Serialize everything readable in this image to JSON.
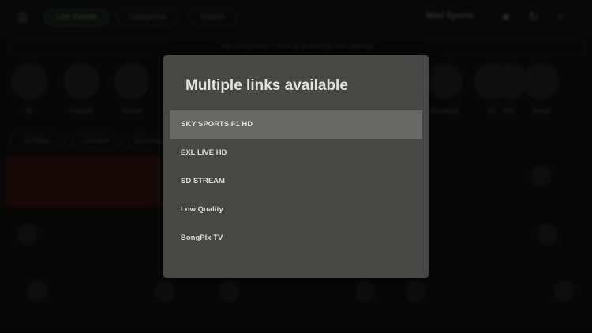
{
  "topbar": {
    "menu_icon": "menu-icon",
    "tabs": [
      "Live Events",
      "Categories",
      "Search"
    ],
    "brand": "Mad Sports",
    "icons": [
      "star-icon",
      "refresh-icon",
      "search-icon"
    ]
  },
  "banner": {
    "text": "Your Live Events — Click on an event to start watching"
  },
  "categories": [
    {
      "label": "All"
    },
    {
      "label": "Football"
    },
    {
      "label": "Cricket"
    },
    {
      "label": "Basketball"
    },
    {
      "label": "F1"
    },
    {
      "label": "NFL"
    },
    {
      "label": "Tennis"
    }
  ],
  "chips": [
    "All Today",
    "Live Now",
    "Upcoming"
  ],
  "dialog": {
    "title": "Multiple links available",
    "options": [
      "SKY SPORTS F1 HD",
      "EXL LIVE HD",
      "SD STREAM",
      "Low Quality",
      "BongPlx TV"
    ],
    "selected_index": 0
  }
}
